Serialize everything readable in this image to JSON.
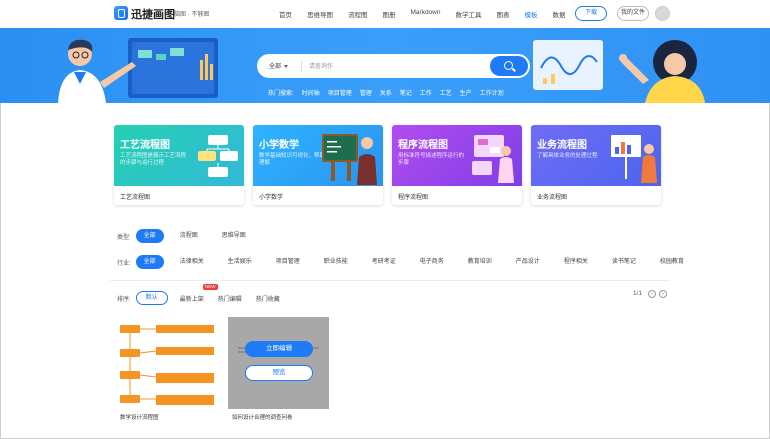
{
  "header": {
    "brand": "迅捷画图",
    "brand_sub": "脑图 · 不够图",
    "nav": [
      "首页",
      "思维导图",
      "流程图",
      "图册",
      "Markdown",
      "数学工具",
      "图表",
      "模板",
      "数据"
    ],
    "active_nav": "模板",
    "download_label": "下载",
    "myfiles_label": "我的文件"
  },
  "search": {
    "scope": "全部",
    "placeholder": "请查询作",
    "hot_label": "热门搜索:",
    "hot_terms": [
      "时间轴",
      "项目管理",
      "管理",
      "关系",
      "笔记",
      "工作",
      "工艺",
      "生产",
      "工作计划"
    ]
  },
  "categories": [
    {
      "title": "工艺流程图",
      "desc": "工艺流程图是展示工艺流程的步骤与运行过程",
      "caption": "工艺流程图",
      "color": "#2cc9b4"
    },
    {
      "title": "小学数学",
      "desc": "数学基础知识可视化，帮助理解",
      "caption": "小学数学",
      "color": "#2aa8f0"
    },
    {
      "title": "程序流程图",
      "desc": "用标准符号描述程序运行的步骤",
      "caption": "程序流程图",
      "color": "#a247e8"
    },
    {
      "title": "业务流程图",
      "desc": "了解具体业务的处理过程",
      "caption": "业务流程图",
      "color": "#5a68f0"
    }
  ],
  "filters": {
    "type_label": "类型:",
    "types": [
      "全部",
      "流程图",
      "思维导图"
    ],
    "industry_label": "行业:",
    "industries": [
      "全部",
      "法律相关",
      "生活娱乐",
      "项目管理",
      "职业技能",
      "考研考证",
      "电子商务",
      "教育培训",
      "产品设计",
      "程序相关",
      "读书笔记",
      "校园教育"
    ],
    "sort_label": "排序:",
    "sorts": [
      "默认",
      "最新上架",
      "热门编辑",
      "热门收藏"
    ],
    "new_badge": "NEW",
    "pager": "1/1"
  },
  "templates": [
    {
      "caption": "数学设计流程图"
    },
    {
      "caption": "如何设计合理的调查问卷",
      "edit_label": "立即编辑",
      "preview_label": "预览"
    }
  ]
}
